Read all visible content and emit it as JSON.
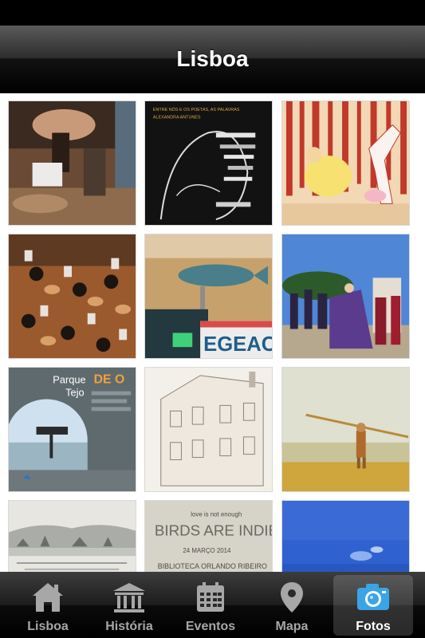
{
  "nav": {
    "title": "Lisboa"
  },
  "photos": [
    {
      "id": "performance"
    },
    {
      "id": "poster-poetas",
      "line1": "ENTRE NÓS E OS POETAS, AS PALAVRAS",
      "line2": "ALEXANDRA ANTUNES"
    },
    {
      "id": "illustration-sheep"
    },
    {
      "id": "orchestra"
    },
    {
      "id": "exhibition-fish",
      "text": "EGEAC"
    },
    {
      "id": "medieval-parade"
    },
    {
      "id": "parque-tejo",
      "title": "Parque",
      "subtitle": "Tejo",
      "headline": "DE O"
    },
    {
      "id": "sketch-building"
    },
    {
      "id": "painting-fisherman"
    },
    {
      "id": "engraving-lisbon"
    },
    {
      "id": "birds-are-indie",
      "line1": "love is not enough",
      "line2": "BIRDS ARE INDIE",
      "line3": "24 MARÇO 2014",
      "line4": "BIBLIOTECA ORLANDO RIBEIRO"
    },
    {
      "id": "blue-abstract"
    }
  ],
  "tabs": [
    {
      "label": "Lisboa",
      "icon": "home-icon",
      "active": false
    },
    {
      "label": "História",
      "icon": "museum-icon",
      "active": false
    },
    {
      "label": "Eventos",
      "icon": "calendar-icon",
      "active": false
    },
    {
      "label": "Mapa",
      "icon": "map-pin-icon",
      "active": false
    },
    {
      "label": "Fotos",
      "icon": "camera-icon",
      "active": true
    }
  ],
  "colors": {
    "tab_active_accent": "#3aa4e6",
    "tab_inactive": "#a7a7a7"
  }
}
